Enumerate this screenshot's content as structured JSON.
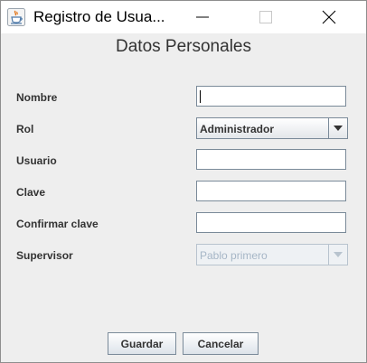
{
  "window": {
    "title": "Registro de Usua...",
    "minimize_icon": "minimize-icon",
    "maximize_icon": "maximize-icon",
    "close_icon": "close-icon",
    "app_icon": "java-cup-icon"
  },
  "form": {
    "heading": "Datos Personales",
    "nombre_label": "Nombre",
    "nombre_value": "",
    "rol_label": "Rol",
    "rol_value": "Administrador",
    "usuario_label": "Usuario",
    "usuario_value": "",
    "clave_label": "Clave",
    "clave_value": "",
    "confirmar_label": "Confirmar clave",
    "confirmar_value": "",
    "supervisor_label": "Supervisor",
    "supervisor_value": "Pablo primero"
  },
  "buttons": {
    "guardar": "Guardar",
    "cancelar": "Cancelar"
  },
  "colors": {
    "accent_border": "#7a8a99",
    "disabled_text": "#a6b6c6",
    "label_text": "#333333"
  }
}
